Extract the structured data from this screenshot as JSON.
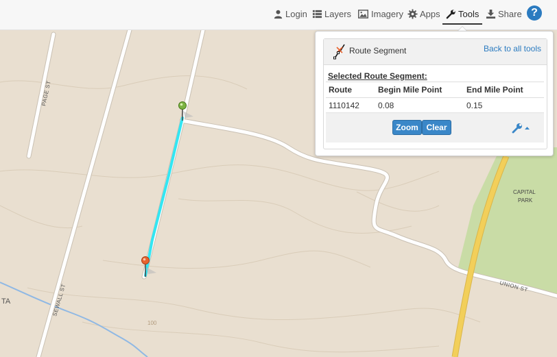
{
  "toolbar": {
    "items": [
      {
        "label": "Login",
        "icon": "user-icon"
      },
      {
        "label": "Layers",
        "icon": "list-icon"
      },
      {
        "label": "Imagery",
        "icon": "image-icon"
      },
      {
        "label": "Apps",
        "icon": "gear-icon"
      },
      {
        "label": "Tools",
        "icon": "wrench-icon",
        "active": true
      },
      {
        "label": "Share",
        "icon": "download-icon"
      }
    ],
    "help_label": "?"
  },
  "tools_panel": {
    "title": "Route Segment",
    "back_link": "Back to all tools",
    "selected_heading": "Selected Route Segment:",
    "table": {
      "headers": [
        "Route",
        "Begin Mile Point",
        "End Mile Point"
      ],
      "rows": [
        [
          "1110142",
          "0.08",
          "0.15"
        ]
      ]
    },
    "buttons": {
      "zoom": "Zoom",
      "clear": "Clear"
    }
  },
  "map": {
    "streets": {
      "page": "PAGE ST",
      "sewall": "SEWALL ST",
      "union": "UNION ST"
    },
    "park_label_line1": "CAPITAL",
    "park_label_line2": "PARK",
    "contour_label": "100",
    "edge_label": "TA"
  },
  "colors": {
    "map_background": "#e9dfd0",
    "road": "#ffffff",
    "highway": "#f2cf5a",
    "park": "#c9dca6",
    "water": "#8fb8e4",
    "route_highlight": "#33e6f2",
    "accent": "#2b7bc0",
    "start_marker": "#7cb342",
    "end_marker": "#e8622d"
  }
}
